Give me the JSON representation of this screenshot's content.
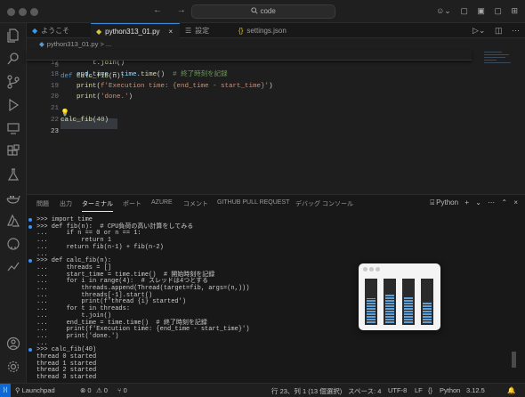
{
  "titlebar": {
    "nav_back": "←",
    "nav_forward": "→",
    "search_text": "code",
    "search_icon": "search-icon",
    "right_icons": [
      "copilot-icon",
      "layout-sidebar-icon",
      "layout-panel-icon",
      "layout-secondary-icon",
      "customize-layout-icon"
    ]
  },
  "tabs": [
    {
      "icon": "vscode-logo-icon",
      "label": "ようこそ",
      "active": false
    },
    {
      "icon": "python-icon",
      "label": "python313_01.py",
      "active": true,
      "close": "×"
    },
    {
      "icon": "settings-icon",
      "label": "設定",
      "active": false
    },
    {
      "icon": "json-icon",
      "label": "settings.json",
      "active": false
    }
  ],
  "breadcrumb": {
    "file": "python313_01.py",
    "separator": ">",
    "more": "..."
  },
  "editor": {
    "sticky": {
      "num": "9",
      "code": [
        [
          "kw",
          "def "
        ],
        [
          "fn",
          "calc_fib"
        ],
        [
          "pl",
          "(n):"
        ]
      ]
    },
    "lines": [
      {
        "num": "17",
        "code": [
          [
            "pl",
            "        t."
          ],
          [
            "fn",
            "join"
          ],
          [
            "pl",
            "()"
          ]
        ]
      },
      {
        "num": "18",
        "code": [
          [
            "vr",
            "    end_time"
          ],
          [
            "pl",
            " = "
          ],
          [
            "vr",
            "time"
          ],
          [
            "pl",
            "."
          ],
          [
            "fn",
            "time"
          ],
          [
            "pl",
            "()  "
          ],
          [
            "cm",
            "# 終了時刻を記録"
          ]
        ]
      },
      {
        "num": "19",
        "code": [
          [
            "fn",
            "    print"
          ],
          [
            "pl",
            "("
          ],
          [
            "st",
            "f'Execution time: {end_time - start_time}'"
          ],
          [
            "pl",
            ")"
          ]
        ]
      },
      {
        "num": "20",
        "code": [
          [
            "fn",
            "    print"
          ],
          [
            "pl",
            "("
          ],
          [
            "st",
            "'done.'"
          ],
          [
            "pl",
            ")"
          ]
        ]
      },
      {
        "num": "21",
        "code": []
      },
      {
        "num": "22",
        "code": [
          [
            "fn",
            "calc_fib"
          ],
          [
            "pl",
            "("
          ],
          [
            "nm",
            "40"
          ],
          [
            "pl",
            ")"
          ]
        ]
      },
      {
        "num": "23",
        "code": []
      }
    ]
  },
  "panel": {
    "tabs": [
      "問題",
      "出力",
      "ターミナル",
      "ポート",
      "AZURE",
      "コメント",
      "GITHUB PULL REQUEST",
      "デバッグ コンソール"
    ],
    "active_tab": "ターミナル",
    "terminal_name": "Python",
    "actions": [
      "+",
      "⌄",
      "⋯",
      "⌃",
      "×"
    ]
  },
  "terminal": [
    {
      "dot": true,
      "text": ">>> import time"
    },
    {
      "dot": true,
      "text": ">>> def fib(n):  # CPU負荷の高い計算をしてみる"
    },
    {
      "dot": false,
      "text": "...     if n == 0 or n == 1:"
    },
    {
      "dot": false,
      "text": "...         return 1"
    },
    {
      "dot": false,
      "text": "...     return fib(n-1) + fib(n-2)"
    },
    {
      "dot": false,
      "text": "..."
    },
    {
      "dot": true,
      "text": ">>> def calc_fib(n):"
    },
    {
      "dot": false,
      "text": "...     threads = []"
    },
    {
      "dot": false,
      "text": "...     start_time = time.time()  # 開始時刻を記録"
    },
    {
      "dot": false,
      "text": "...     for i in range(4):  # スレッドは4つとする"
    },
    {
      "dot": false,
      "text": "...         threads.append(Thread(target=fib, args=(n,)))"
    },
    {
      "dot": false,
      "text": "...         threads[-1].start()"
    },
    {
      "dot": false,
      "text": "...         print(f'thread {i} started')"
    },
    {
      "dot": false,
      "text": "...     for t in threads:"
    },
    {
      "dot": false,
      "text": "...         t.join()"
    },
    {
      "dot": false,
      "text": "...     end_time = time.time()  # 終了時刻を記録"
    },
    {
      "dot": false,
      "text": "...     print(f'Execution time: {end_time - start_time}')"
    },
    {
      "dot": false,
      "text": "...     print('done.')"
    },
    {
      "dot": false,
      "text": "..."
    },
    {
      "dot": true,
      "text": ">>> calc_fib(40)"
    },
    {
      "dot": false,
      "text": "thread 0 started"
    },
    {
      "dot": false,
      "text": "thread 1 started"
    },
    {
      "dot": false,
      "text": "thread 2 started"
    },
    {
      "dot": false,
      "text": "thread 3 started"
    }
  ],
  "cpu_widget": {
    "cores": [
      0.58,
      0.68,
      0.62,
      0.5
    ]
  },
  "statusbar": {
    "launchpad": "Launchpad",
    "errors": "⊗ 0",
    "warnings": "⚠ 0",
    "ports": "⑂ 0",
    "cursor": "行 23、列 1 (13 個選択)",
    "spaces": "スペース: 4",
    "encoding": "UTF-8",
    "eol": "LF",
    "braces": "{}",
    "language": "Python",
    "version": "3.12.5"
  },
  "colors": {
    "accent": "#3794ff",
    "status_remote": "#0b6ad7",
    "cpu_bar": "#5ea0d6"
  }
}
